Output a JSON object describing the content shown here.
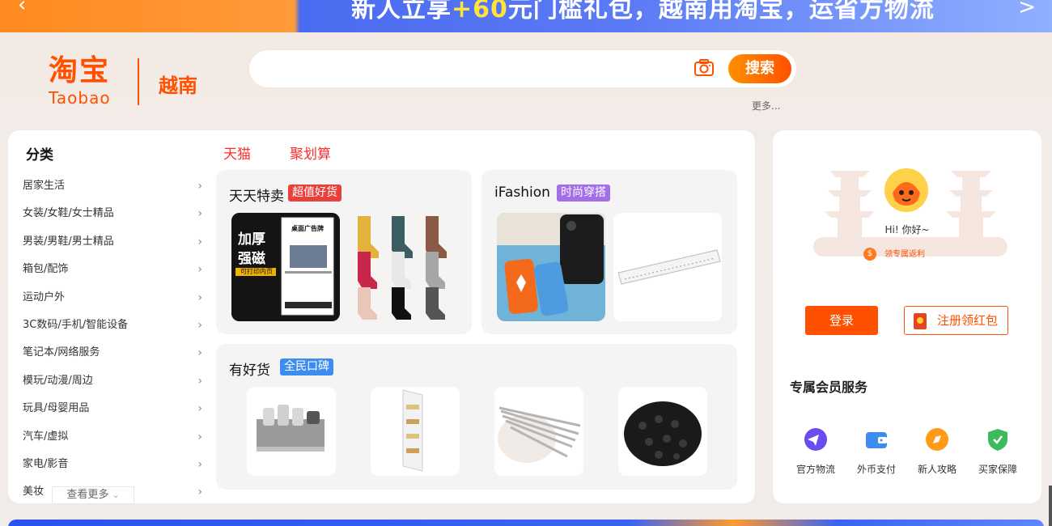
{
  "banner": {
    "text_prefix": "新人立享",
    "text_highlight": "+60",
    "text_suffix": "元门槛礼包，越南用淘宝，运省方物流",
    "chevron": ">"
  },
  "logo": {
    "cn": "淘宝",
    "en": "Taobao",
    "region": "越南"
  },
  "search": {
    "placeholder": "",
    "button_label": "搜索",
    "more_label": "更多..."
  },
  "categories": {
    "title": "分类",
    "items": [
      "居家生活",
      "女装/女鞋/女士精品",
      "男装/男鞋/男士精品",
      "箱包/配饰",
      "运动户外",
      "3C数码/手机/智能设备",
      "笔记本/网络服务",
      "模玩/动漫/周边",
      "玩具/母婴用品",
      "汽车/虚拟",
      "家电/影音",
      "美妆"
    ],
    "view_more": "查看更多"
  },
  "tabs": {
    "tmall": "天猫",
    "juhuasuan": "聚划算"
  },
  "cards": {
    "daily": {
      "title": "天天特卖",
      "badge": "超值好货",
      "badge_color": "#e8413b",
      "poster": {
        "line1": "加厚",
        "line2": "强磁",
        "tag": "可打印内页",
        "sign": "桌面广告牌"
      }
    },
    "ifashion": {
      "title": "iFashion",
      "badge": "时尚穿搭",
      "badge_color": "#a36ee8"
    },
    "goodgoods": {
      "title": "有好货",
      "badge": "全民口碑",
      "badge_color": "#3d8cf0"
    }
  },
  "user": {
    "greeting": "Hi! 你好~",
    "rebate": "领专属返利",
    "rebate_coin": "$",
    "login": "登录",
    "register": "注册领红包"
  },
  "member": {
    "title": "专属会员服务",
    "services": [
      {
        "label": "官方物流",
        "icon": "logistics-icon",
        "color": "#6a4cf0"
      },
      {
        "label": "外币支付",
        "icon": "wallet-icon",
        "color": "#3d8cf0"
      },
      {
        "label": "新人攻略",
        "icon": "compass-icon",
        "color": "#ff9a1a"
      },
      {
        "label": "买家保障",
        "icon": "shield-icon",
        "color": "#3cba5c"
      }
    ]
  },
  "colors": {
    "brand": "#ff5000",
    "tab_red": "#ff2d2d"
  }
}
